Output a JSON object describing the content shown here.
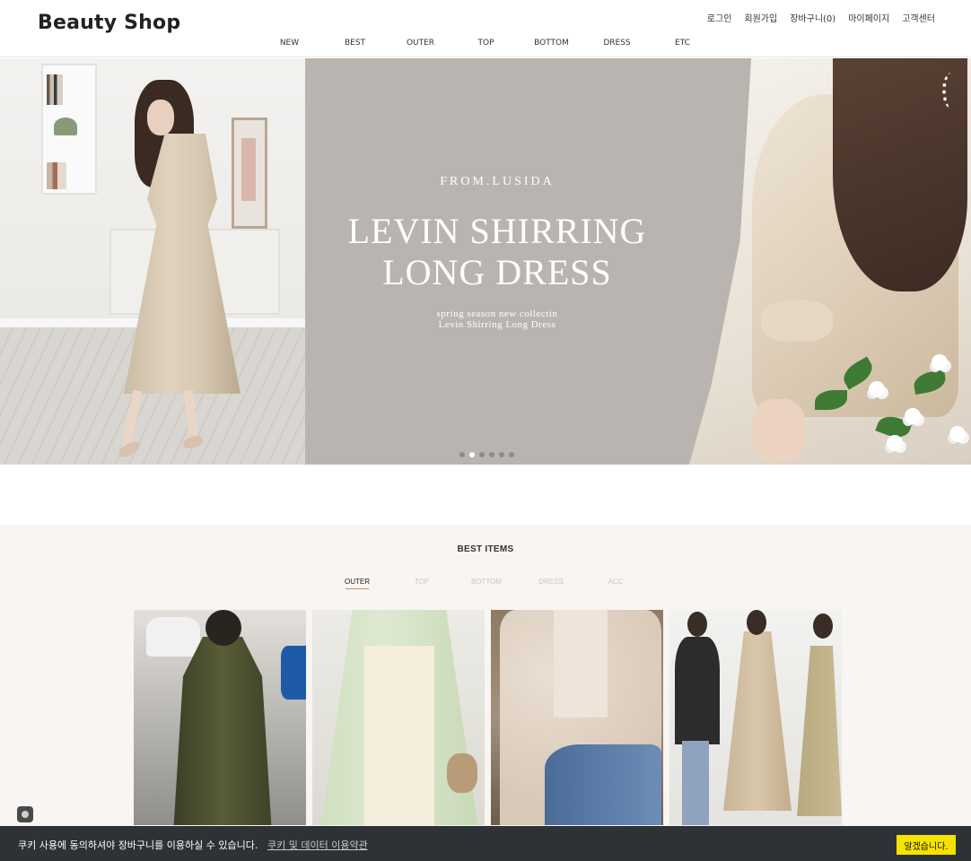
{
  "header": {
    "logo": "Beauty Shop",
    "util_links": [
      "로그인",
      "회원가입",
      "장바구니(0)",
      "마이페이지",
      "고객센터"
    ],
    "nav": [
      "NEW",
      "BEST",
      "OUTER",
      "TOP",
      "BOTTOM",
      "DRESS",
      "ETC"
    ]
  },
  "hero": {
    "brand": "FROM.LUSIDA",
    "title_line1": "LEVIN SHIRRING",
    "title_line2": "LONG DRESS",
    "sub_line1": "spring season new collectin",
    "sub_line2": "Levin Shirring Long Dress",
    "slide_count": 6,
    "active_slide": 2
  },
  "best": {
    "title": "BEST ITEMS",
    "tabs": [
      "OUTER",
      "TOP",
      "BOTTOM",
      "DRESS",
      "ACC"
    ],
    "active_tab": "OUTER"
  },
  "cookie": {
    "message": "쿠키 사용에 동의하셔야 장바구니를 이용하실 수 있습니다.",
    "link": "쿠키 및 데이터 이용약관",
    "button": "알겠습니다."
  },
  "colors": {
    "hero_bg": "#b9b4af",
    "best_bg": "#f8f5f2",
    "cookie_bg": "#2e3236",
    "cookie_button": "#f5e200"
  }
}
